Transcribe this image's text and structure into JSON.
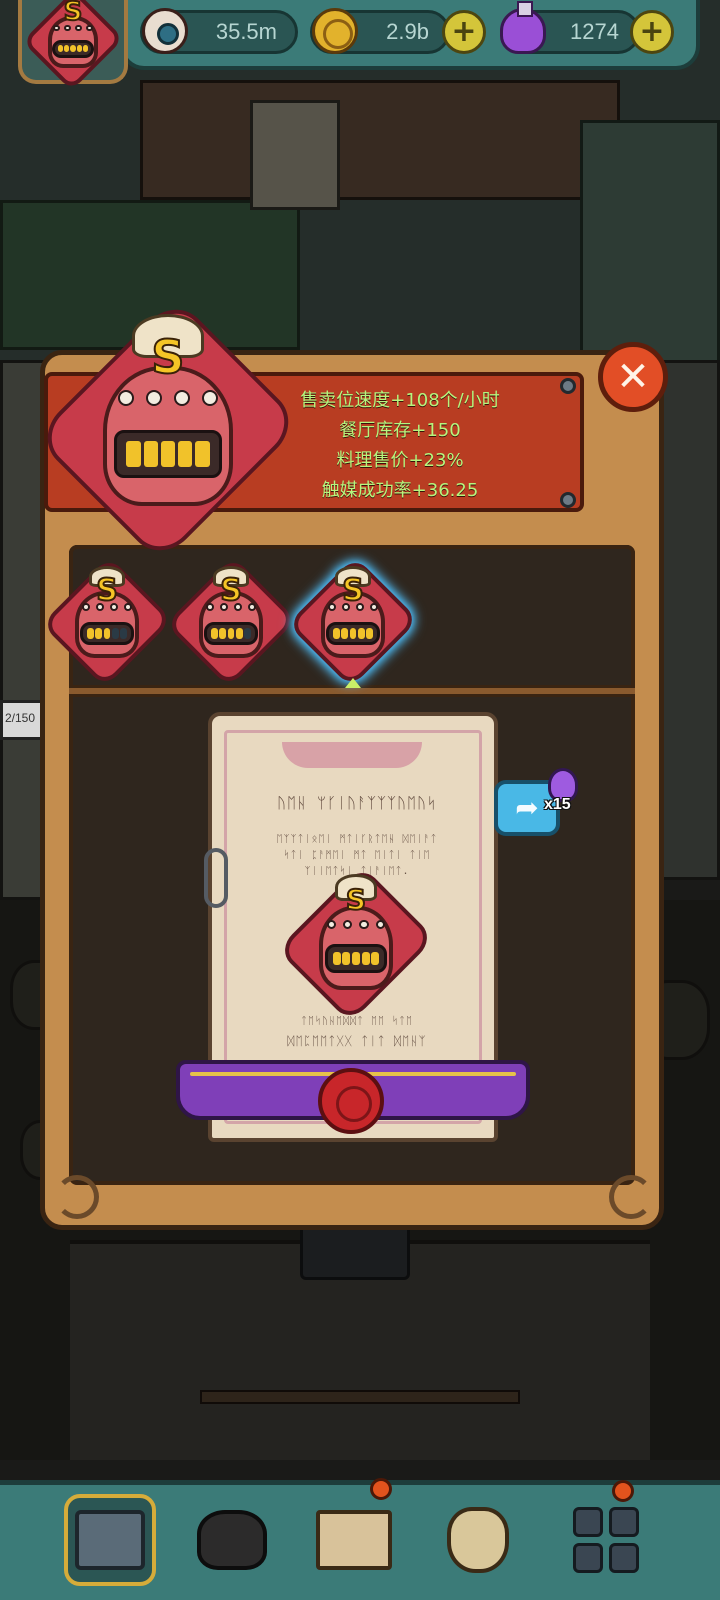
{
  "topbar": {
    "eyes": "35.5m",
    "coins": "2.9b",
    "potions": "1274",
    "eye_icon": "eyeball-icon",
    "coin_icon": "coin-icon",
    "potion_icon": "potion-icon",
    "add_icon": "plus-icon"
  },
  "avatar": {
    "grade": "S"
  },
  "upgrade_panel": {
    "grade": "S",
    "stats": [
      "售卖位速度+108个/小时",
      "餐厅库存+150",
      "料理售价+23%",
      "触媒成功率+36.25"
    ],
    "close_icon": "close-icon",
    "stat_color": "#b6f57e"
  },
  "grade_options": [
    {
      "grade": "S",
      "teeth_filled": 3,
      "selected": false
    },
    {
      "grade": "S",
      "teeth_filled": 4,
      "selected": false
    },
    {
      "grade": "S",
      "teeth_filled": 5,
      "selected": true
    }
  ],
  "scroll": {
    "title": "ᚢᛖᚺ ᛘᚴᛁᚢᚨᛉᛉᛉᚢᛖᚢᛋ",
    "line1": "ᛖᛉᛉᛏᛁᛟᛖᛁ ᛗᛏᛁᚴᚱᛏᛖᚺ ᛞᛖᛁᚨᛏ",
    "line2": "ᛋᛏᛁ ᛈᚨᛗᛖᛁ ᛗᛏ ᛖᛁᛏᛁ ᛏᛁᛖ",
    "line3": "ᛉᛁᛁᛖᛏᛋᛁ ᛏᛁᚨᛁᛖᛏ.",
    "line4": "ᛏᛖᛋᚢᚺᛖᛞᛞᛏ ᛖᛖ ᛋᛏᛖ",
    "line5": "ᛞᛖᛈᛖᛖᛏᚷᚷ ᛏᛁᛏ ᛞᛖᚺᛉ",
    "grade": "S"
  },
  "share": {
    "icon": "share-icon",
    "reward_icon": "potion-icon",
    "reward_count": "x15"
  },
  "side_hud": {
    "label": "2/150"
  },
  "bottom_nav": [
    {
      "name": "shop",
      "icon": "shop-icon"
    },
    {
      "name": "monster",
      "icon": "monster-icon"
    },
    {
      "name": "book",
      "icon": "book-icon"
    },
    {
      "name": "bag",
      "icon": "money-bag-icon"
    },
    {
      "name": "grid",
      "icon": "grid-icon"
    }
  ]
}
